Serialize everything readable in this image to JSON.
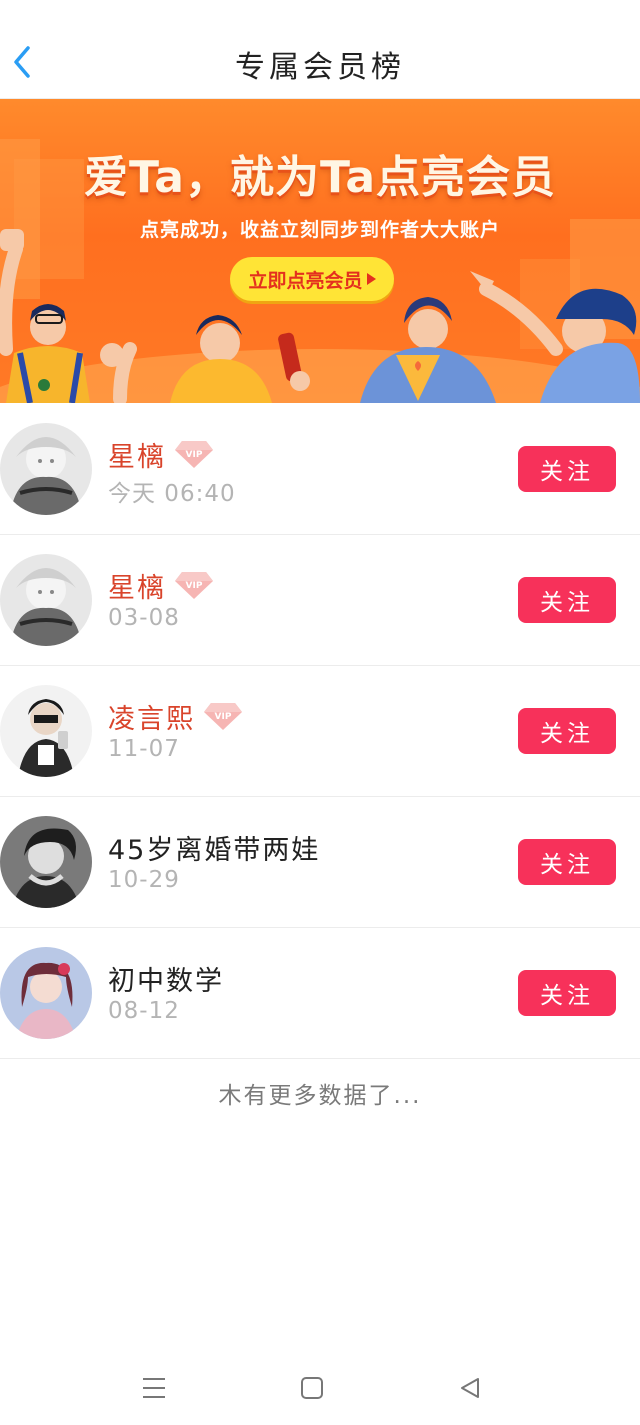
{
  "header": {
    "title": "专属会员榜",
    "back_icon": "chevron-left-icon"
  },
  "banner": {
    "title": "爱Ta，就为Ta点亮会员",
    "subtitle": "点亮成功，收益立刻同步到作者大大账户",
    "cta_label": "立即点亮会员"
  },
  "members": [
    {
      "name": "星樆",
      "vip": true,
      "time": "今天 06:40",
      "follow_label": "关注"
    },
    {
      "name": "星樆",
      "vip": true,
      "time": "03-08",
      "follow_label": "关注"
    },
    {
      "name": "凌言熙",
      "vip": true,
      "time": "11-07",
      "follow_label": "关注"
    },
    {
      "name": "45岁离婚带两娃",
      "vip": false,
      "time": "10-29",
      "follow_label": "关注"
    },
    {
      "name": "初中数学",
      "vip": false,
      "time": "08-12",
      "follow_label": "关注"
    }
  ],
  "vip_badge_text": "VIP",
  "footer_note": "木有更多数据了...",
  "colors": {
    "accent": "#f7315a",
    "vip_name": "#d9442b",
    "back_arrow": "#2a9df4",
    "banner_orange": "#ff7a26",
    "cta_yellow": "#ffe436"
  },
  "navbar": {
    "menu_icon": "menu-icon",
    "home_icon": "square-home-icon",
    "back_icon": "triangle-back-icon"
  }
}
